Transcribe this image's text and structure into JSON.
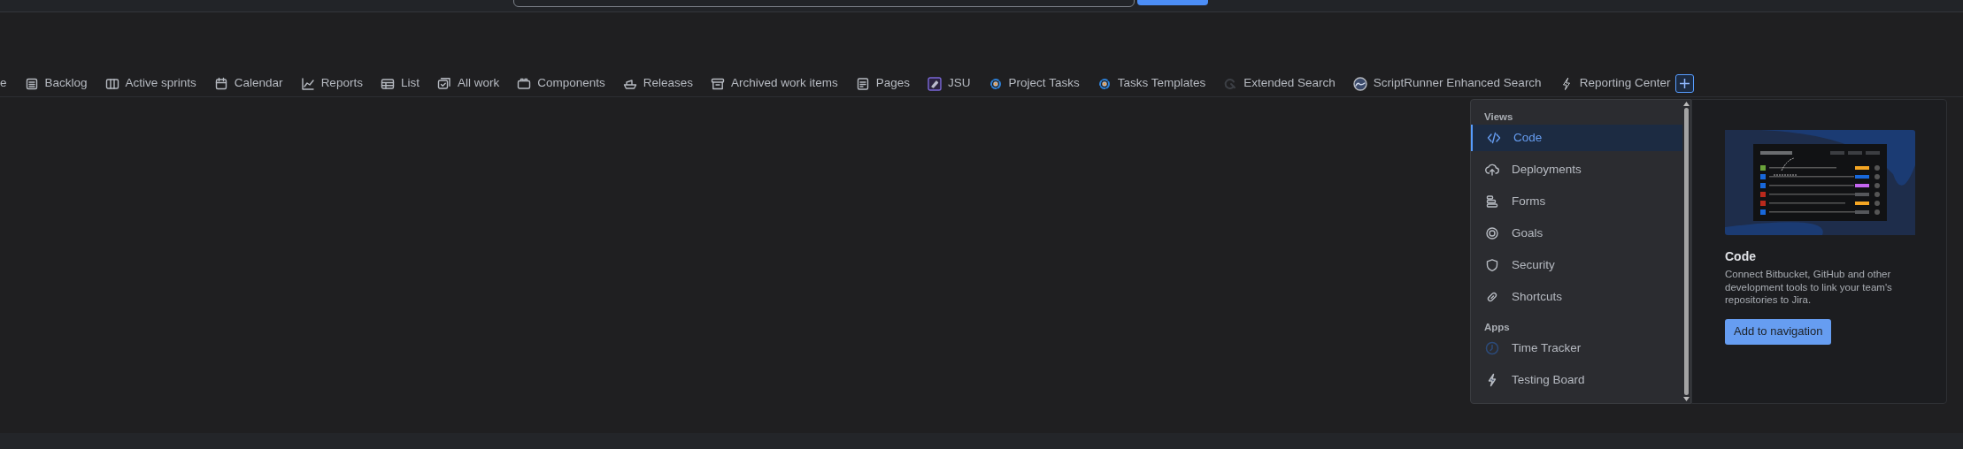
{
  "tabs": [
    {
      "label": "e"
    },
    {
      "label": "Backlog"
    },
    {
      "label": "Active sprints"
    },
    {
      "label": "Calendar"
    },
    {
      "label": "Reports"
    },
    {
      "label": "List"
    },
    {
      "label": "All work"
    },
    {
      "label": "Components"
    },
    {
      "label": "Releases"
    },
    {
      "label": "Archived work items"
    },
    {
      "label": "Pages"
    },
    {
      "label": "JSU"
    },
    {
      "label": "Project Tasks"
    },
    {
      "label": "Tasks Templates"
    },
    {
      "label": "Extended Search"
    },
    {
      "label": "ScriptRunner Enhanced Search"
    },
    {
      "label": "Reporting Center"
    }
  ],
  "menu": {
    "sections": [
      {
        "heading": "Views",
        "items": [
          {
            "label": "Code",
            "selected": true
          },
          {
            "label": "Deployments",
            "selected": false
          },
          {
            "label": "Forms",
            "selected": false
          },
          {
            "label": "Goals",
            "selected": false
          },
          {
            "label": "Security",
            "selected": false
          },
          {
            "label": "Shortcuts",
            "selected": false
          }
        ]
      },
      {
        "heading": "Apps",
        "items": [
          {
            "label": "Time Tracker",
            "selected": false
          },
          {
            "label": "Testing Board",
            "selected": false
          }
        ]
      }
    ]
  },
  "preview": {
    "title": "Code",
    "description": "Connect Bitbucket, GitHub and other development tools to link your team's repositories to Jira.",
    "button": "Add to navigation"
  }
}
